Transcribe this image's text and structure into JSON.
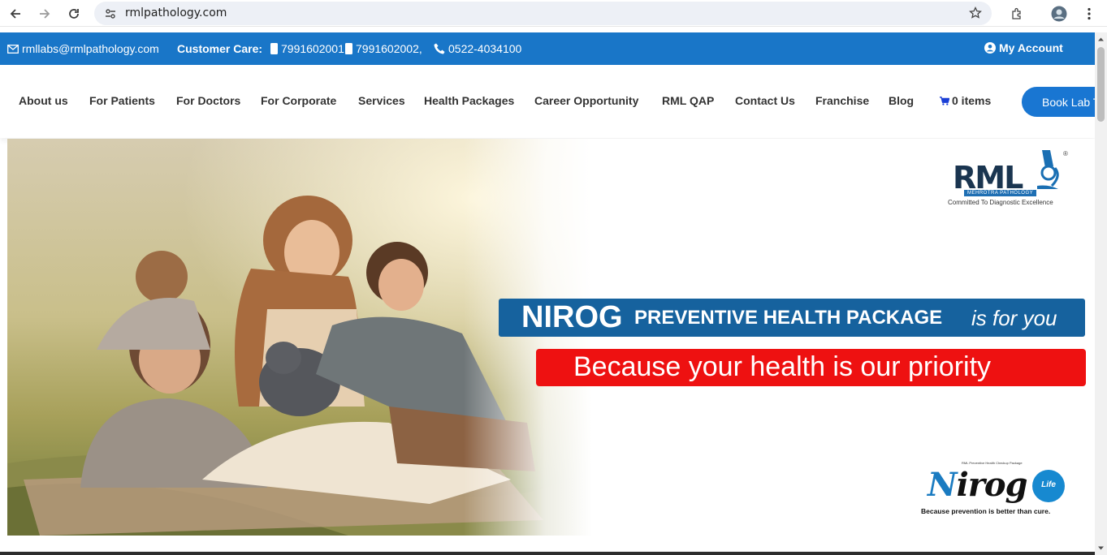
{
  "browser": {
    "url": "rmlpathology.com",
    "icons": [
      "back-icon",
      "forward-icon",
      "reload-icon",
      "site-info-icon",
      "bookmark-star-icon",
      "extensions-icon",
      "profile-avatar",
      "menu-dots-icon"
    ]
  },
  "info_bar": {
    "email": "rmllabs@rmlpathology.com",
    "customer_care_label": "Customer Care:",
    "phone1": "7991602001,",
    "phone2": "7991602002,",
    "landline": "0522-4034100",
    "my_account": "My Account",
    "background_color": "#1976c8"
  },
  "nav": {
    "items": [
      "About us",
      "For Patients",
      "For Doctors",
      "For Corporate",
      "Services",
      "Health Packages",
      "Career Opportunity",
      "RML QAP",
      "Contact Us",
      "Franchise",
      "Blog"
    ],
    "cart_label": "0 items",
    "book_button": "Book Lab T"
  },
  "hero": {
    "logo": {
      "letters": "RML",
      "strip": "MEHROTRA PATHOLOGY",
      "tagline": "Committed To Diagnostic Excellence",
      "reg": "®"
    },
    "banner_blue": {
      "part1": "NIROG",
      "part2": "PREVENTIVE HEALTH PACKAGE",
      "part3": "is for you",
      "color": "#16629e"
    },
    "banner_red": {
      "text": "Because your health is our priority",
      "color": "#ee1111"
    },
    "nirog_logo": {
      "n": "N",
      "rest": "irog",
      "life": "Life",
      "small": "RML Preventive Health Checkup Package",
      "tagline": "Because prevention is better than cure."
    }
  }
}
